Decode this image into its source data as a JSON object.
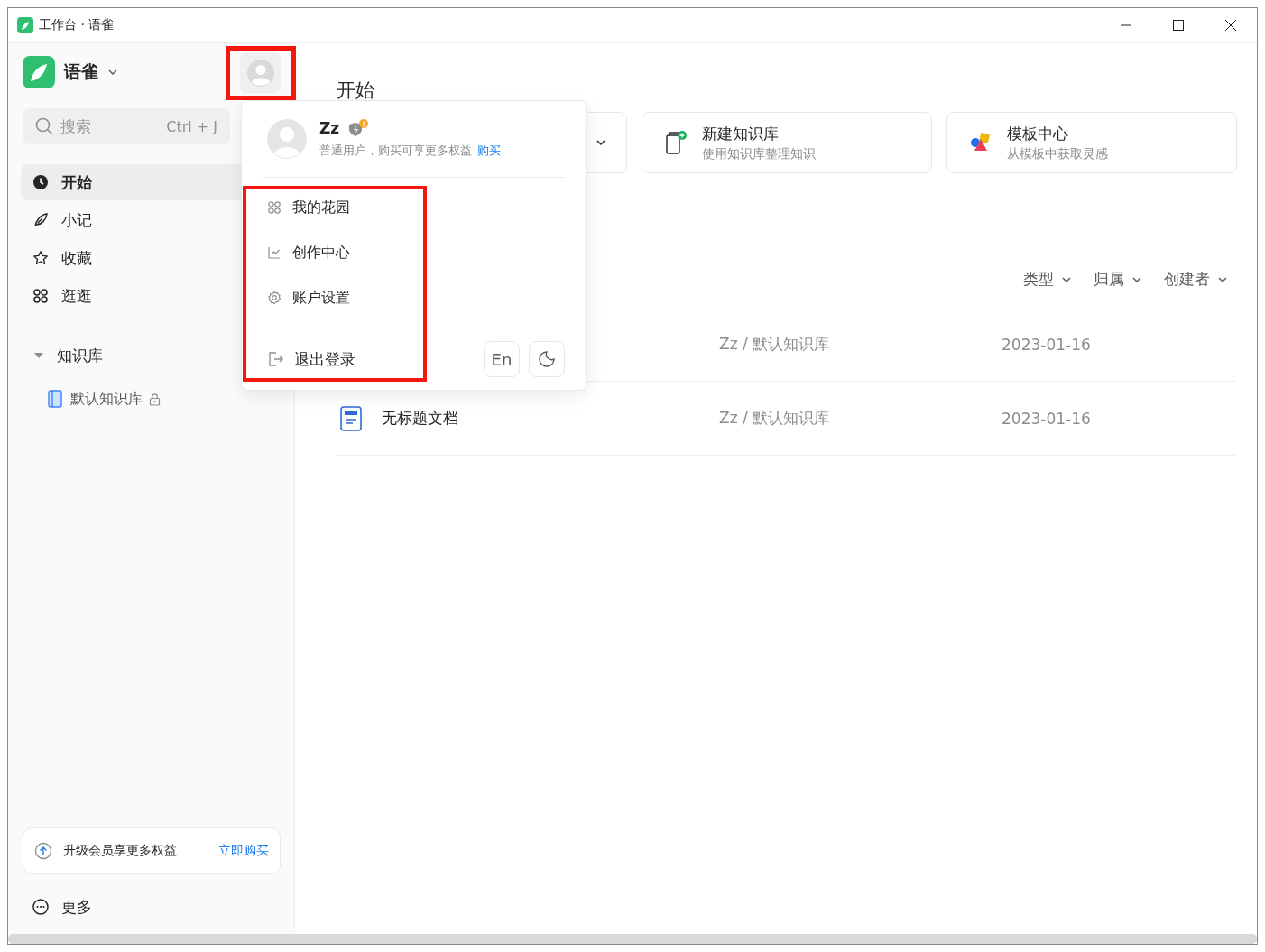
{
  "window": {
    "title": "工作台 · 语雀"
  },
  "sidebar": {
    "brand": "语雀",
    "search": {
      "placeholder": "搜索",
      "shortcut": "Ctrl + J"
    },
    "nav": [
      {
        "label": "开始",
        "selected": true
      },
      {
        "label": "小记",
        "selected": false
      },
      {
        "label": "收藏",
        "selected": false
      },
      {
        "label": "逛逛",
        "selected": false
      }
    ],
    "library": {
      "label": "知识库",
      "expanded": true,
      "children": [
        {
          "label": "默认知识库",
          "locked": true
        }
      ]
    },
    "upgrade": {
      "text": "升级会员享更多权益",
      "link": "立即购买"
    },
    "more": "更多"
  },
  "main": {
    "heading": "开始",
    "cards": [
      {
        "kind": "dropdown"
      },
      {
        "kind": "action",
        "title": "新建知识库",
        "subtitle": "使用知识库整理知识"
      },
      {
        "kind": "action",
        "title": "模板中心",
        "subtitle": "从模板中获取灵感"
      }
    ],
    "filters": [
      "类型",
      "归属",
      "创建者"
    ],
    "rows": [
      {
        "path": "Zz / 默认知识库",
        "date": "2023-01-16"
      },
      {
        "title": "无标题文档",
        "path": "Zz / 默认知识库",
        "date": "2023-01-16"
      }
    ]
  },
  "user_menu": {
    "name": "Zz",
    "role": "普通用户，购买可享更多权益",
    "buy": "购买",
    "items": [
      {
        "label": "我的花园"
      },
      {
        "label": "创作中心"
      },
      {
        "label": "账户设置"
      }
    ],
    "logout": "退出登录",
    "language": "En"
  },
  "highlights": [
    {
      "color": "#f5170f"
    },
    {
      "color": "#f5170f"
    }
  ]
}
